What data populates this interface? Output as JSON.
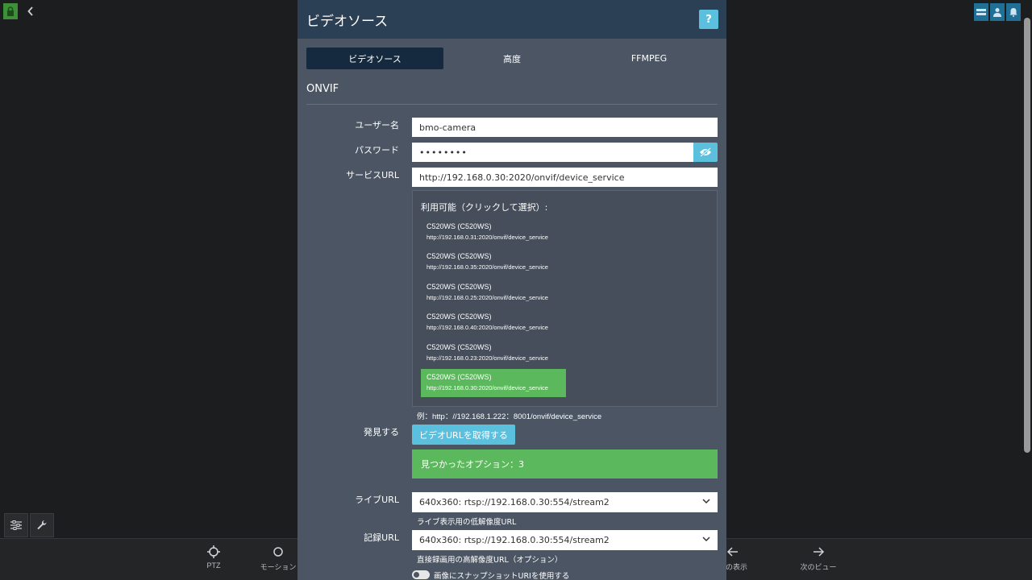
{
  "background": {
    "bottom_bar": {
      "items": [
        {
          "label": "PTZ",
          "icon": "crosshair-icon"
        },
        {
          "label": "モーション",
          "icon": "motion-icon"
        },
        {
          "label": "前の表示",
          "icon": "arrow-left-icon"
        },
        {
          "label": "次のビュー",
          "icon": "arrow-right-icon"
        }
      ]
    }
  },
  "modal": {
    "title": "ビデオソース",
    "help_label": "?",
    "tabs": [
      {
        "label": "ビデオソース",
        "active": true
      },
      {
        "label": "高度",
        "active": false
      },
      {
        "label": "FFMPEG",
        "active": false
      }
    ],
    "section_title": "ONVIF",
    "fields": {
      "username": {
        "label": "ユーザー名",
        "value": "bmo-camera"
      },
      "password": {
        "label": "パスワード",
        "value": "••••••••"
      },
      "service_url": {
        "label": "サービスURL",
        "value": "http://192.168.0.30:2020/onvif/device_service"
      }
    },
    "available": {
      "title": "利用可能（クリックして選択）:",
      "items": [
        {
          "name": "C520WS (C520WS)",
          "url": "http://192.168.0.31:2020/onvif/device_service",
          "selected": false
        },
        {
          "name": "C520WS (C520WS)",
          "url": "http://192.168.0.35:2020/onvif/device_service",
          "selected": false
        },
        {
          "name": "C520WS (C520WS)",
          "url": "http://192.168.0.25:2020/onvif/device_service",
          "selected": false
        },
        {
          "name": "C520WS (C520WS)",
          "url": "http://192.168.0.40:2020/onvif/device_service",
          "selected": false
        },
        {
          "name": "C520WS (C520WS)",
          "url": "http://192.168.0.23:2020/onvif/device_service",
          "selected": false
        },
        {
          "name": "C520WS (C520WS)",
          "url": "http://192.168.0.30:2020/onvif/device_service",
          "selected": true
        }
      ]
    },
    "example": "例：http：//192.168.1.222：8001/onvif/device_service",
    "discover": {
      "label": "発見する",
      "button": "ビデオURLを取得する"
    },
    "found": "見つかったオプション：3",
    "live_url": {
      "label": "ライブURL",
      "value": "640x360: rtsp://192.168.0.30:554/stream2",
      "help": "ライブ表示用の低解像度URL"
    },
    "record_url": {
      "label": "記録URL",
      "value": "640x360: rtsp://192.168.0.30:554/stream2",
      "help": "直接録画用の高解像度URL（オプション）"
    },
    "snapshot_toggle": {
      "label": "画像にスナップショットURIを使用する",
      "on": false
    }
  },
  "colors": {
    "accent": "#5bc0de",
    "success": "#5cb85c",
    "header": "#2b3f55",
    "panel": "#4b5563"
  }
}
